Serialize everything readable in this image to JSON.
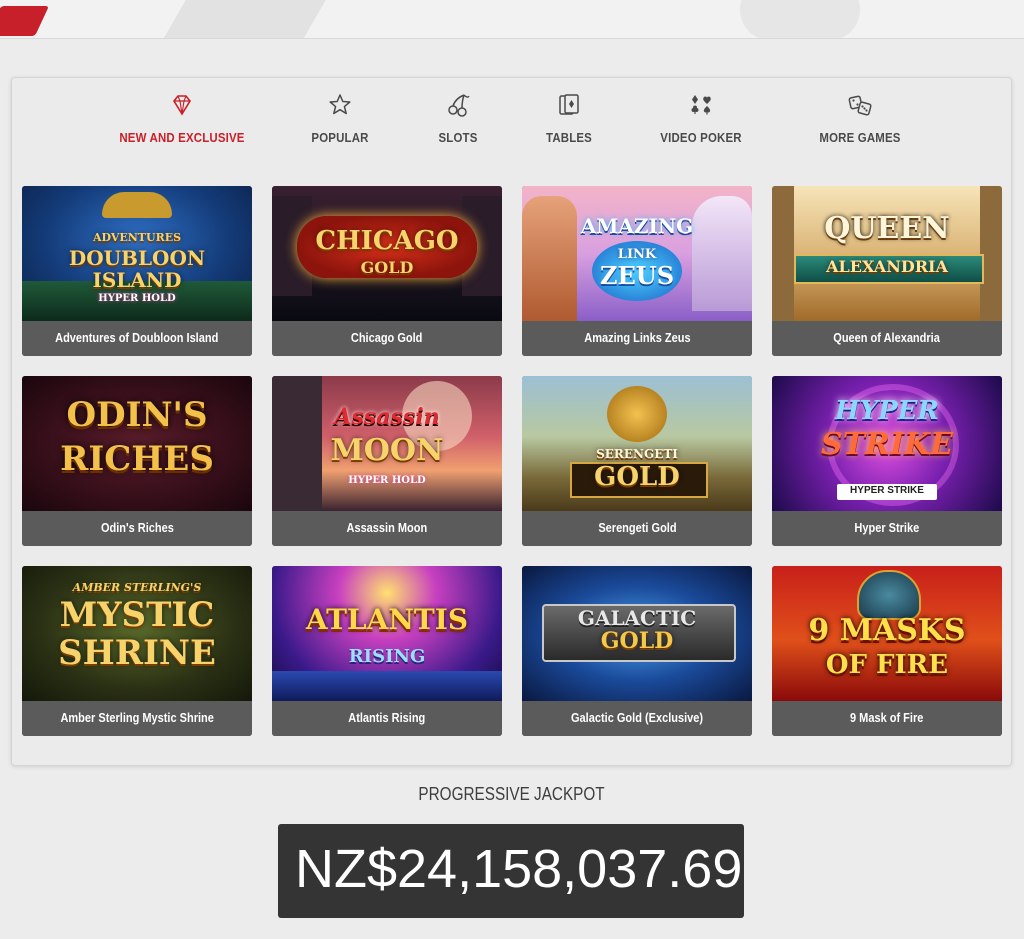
{
  "tabs": [
    {
      "label": "NEW AND EXCLUSIVE",
      "icon": "diamond-icon",
      "active": true
    },
    {
      "label": "POPULAR",
      "icon": "star-icon",
      "active": false
    },
    {
      "label": "SLOTS",
      "icon": "cherries-icon",
      "active": false
    },
    {
      "label": "TABLES",
      "icon": "playing-cards-icon",
      "active": false
    },
    {
      "label": "VIDEO POKER",
      "icon": "card-suits-icon",
      "active": false
    },
    {
      "label": "MORE GAMES",
      "icon": "dice-icon",
      "active": false
    }
  ],
  "games": [
    {
      "title": "Adventures of Doubloon Island",
      "logo": [
        "ADVENTURES",
        "DOUBLOON",
        "ISLAND",
        "HYPER HOLD"
      ]
    },
    {
      "title": "Chicago Gold",
      "logo": [
        "CHICAGO",
        "GOLD"
      ]
    },
    {
      "title": "Amazing Links Zeus",
      "logo": [
        "AMAZING",
        "LINK",
        "ZEUS"
      ]
    },
    {
      "title": "Queen of Alexandria",
      "logo": [
        "QUEEN",
        "ALEXANDRIA"
      ]
    },
    {
      "title": "Odin's Riches",
      "logo": [
        "ODIN'S",
        "RICHES"
      ]
    },
    {
      "title": "Assassin Moon",
      "logo": [
        "Assassin",
        "MOON",
        "HYPER HOLD"
      ]
    },
    {
      "title": "Serengeti Gold",
      "logo": [
        "SERENGETI",
        "GOLD"
      ]
    },
    {
      "title": "Hyper Strike",
      "logo": [
        "HYPER",
        "STRIKE",
        "HYPER STRIKE"
      ]
    },
    {
      "title": "Amber Sterling Mystic Shrine",
      "logo": [
        "AMBER STERLING'S",
        "MYSTIC",
        "SHRINE"
      ]
    },
    {
      "title": "Atlantis Rising",
      "logo": [
        "ATLANTIS",
        "RISING"
      ]
    },
    {
      "title": "Galactic Gold (Exclusive)",
      "logo": [
        "GALACTIC",
        "GOLD"
      ]
    },
    {
      "title": "9 Mask of Fire",
      "logo": [
        "9 MASKS",
        "OF FIRE"
      ]
    }
  ],
  "jackpot": {
    "title": "PROGRESSIVE JACKPOT",
    "value": "NZ$24,158,037.69"
  },
  "colors": {
    "accent": "#c9202a",
    "caption_bg": "#5b5b5b",
    "jackpot_bg": "#343434"
  }
}
